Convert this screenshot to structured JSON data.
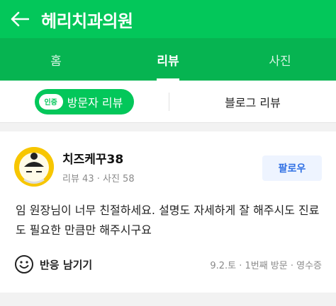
{
  "header": {
    "title": "헤리치과의원",
    "back_icon": "arrow-left-icon"
  },
  "tabs": [
    {
      "label": "홈",
      "active": false
    },
    {
      "label": "리뷰",
      "active": true
    },
    {
      "label": "사진",
      "active": false
    }
  ],
  "subtabs": {
    "visitor": {
      "badge": "인증",
      "label": "방문자 리뷰"
    },
    "blog": {
      "label": "블로그 리뷰"
    }
  },
  "review": {
    "username": "치즈케꾸38",
    "meta": "리뷰 43 · 사진 58",
    "follow_label": "팔로우",
    "text": "임 원장님이 너무 친절하세요. 설명도 자세하게 잘 해주시도 진료도 필요한 만큼만 해주시구요",
    "reaction_label": "반응 남기기",
    "visit_meta": "9.2.토 · 1번째 방문 · 영수증"
  },
  "colors": {
    "brand_green": "#03c75a",
    "follow_blue": "#2f6fe4"
  }
}
